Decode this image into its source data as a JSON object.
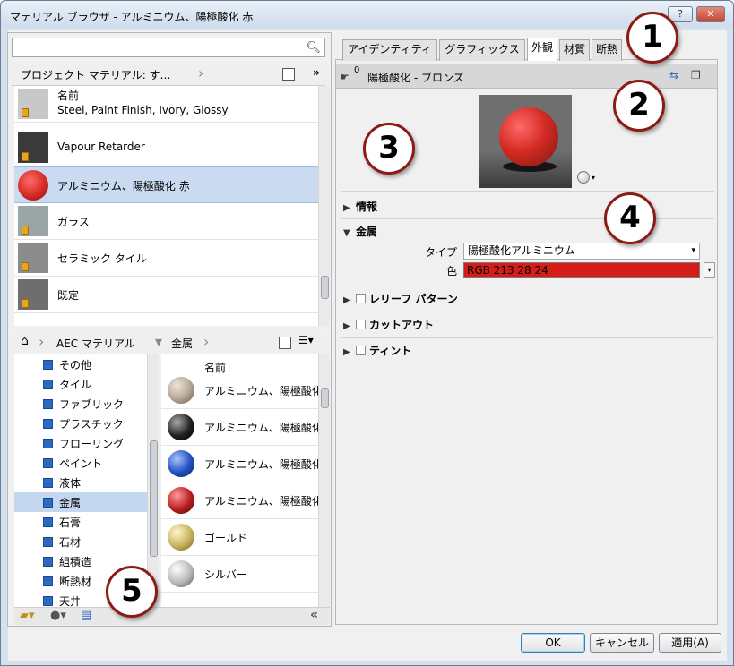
{
  "window": {
    "title": "マテリアル ブラウザ - アルミニウム、陽極酸化 赤",
    "help_label": "?",
    "close_label": "✕"
  },
  "search": {
    "placeholder": "",
    "icon": "search-icon"
  },
  "project_bar": {
    "label": "プロジェクト マテリアル: す…",
    "more": "»"
  },
  "project_list": {
    "header": "名前",
    "items": [
      {
        "label": "Steel, Paint Finish, Ivory, Glossy",
        "thumb": "#c8c8c8",
        "selected": false
      },
      {
        "label": "Vapour Retarder",
        "thumb": "#3a3a3a",
        "selected": false
      },
      {
        "label": "アルミニウム、陽極酸化 赤",
        "thumb": "#d52c24",
        "selected": true
      },
      {
        "label": "ガラス",
        "thumb": "#9aa5a5",
        "selected": false
      },
      {
        "label": "セラミック タイル",
        "thumb": "#8c8c8c",
        "selected": false
      },
      {
        "label": "既定",
        "thumb": "#6e6e6e",
        "selected": false
      }
    ]
  },
  "library_bar": {
    "crumbs": [
      "AEC マテリアル",
      "金属"
    ]
  },
  "tree": {
    "items": [
      {
        "label": "その他",
        "selected": false
      },
      {
        "label": "タイル",
        "selected": false
      },
      {
        "label": "ファブリック",
        "selected": false
      },
      {
        "label": "プラスチック",
        "selected": false
      },
      {
        "label": "フローリング",
        "selected": false
      },
      {
        "label": "ペイント",
        "selected": false
      },
      {
        "label": "液体",
        "selected": false
      },
      {
        "label": "金属",
        "selected": true
      },
      {
        "label": "石膏",
        "selected": false
      },
      {
        "label": "石材",
        "selected": false
      },
      {
        "label": "組積造",
        "selected": false
      },
      {
        "label": "断熱材",
        "selected": false
      },
      {
        "label": "天井",
        "selected": false
      }
    ]
  },
  "library_list": {
    "header": "名前",
    "items": [
      {
        "label": "アルミニウム、陽極酸化",
        "color": "#b9a99a"
      },
      {
        "label": "アルミニウム、陽極酸化",
        "color": "#202020"
      },
      {
        "label": "アルミニウム、陽極酸化",
        "color": "#1f4fc0"
      },
      {
        "label": "アルミニウム、陽極酸化",
        "color": "#b81c1c"
      },
      {
        "label": "ゴールド",
        "color": "#c8b25c"
      },
      {
        "label": "シルバー",
        "color": "#b8b8b8"
      }
    ]
  },
  "tabs": [
    {
      "label": "アイデンティティ",
      "active": false
    },
    {
      "label": "グラフィックス",
      "active": false
    },
    {
      "label": "外観",
      "active": true
    },
    {
      "label": "材質",
      "active": false
    },
    {
      "label": "断熱",
      "active": false
    }
  ],
  "asset": {
    "count": "0",
    "name": "陽極酸化 - ブロンズ"
  },
  "sections": {
    "info": "情報",
    "metal": "金属",
    "type_label": "タイプ",
    "type_value": "陽極酸化アルミニウム",
    "color_label": "色",
    "color_value": "RGB 213 28 24",
    "color_hex": "#d51c18",
    "relief": "レリーフ パターン",
    "cutout": "カットアウト",
    "tint": "ティント"
  },
  "callouts": [
    "1",
    "2",
    "3",
    "4",
    "5"
  ],
  "buttons": {
    "ok": "OK",
    "cancel": "キャンセル",
    "apply": "適用(A)"
  }
}
